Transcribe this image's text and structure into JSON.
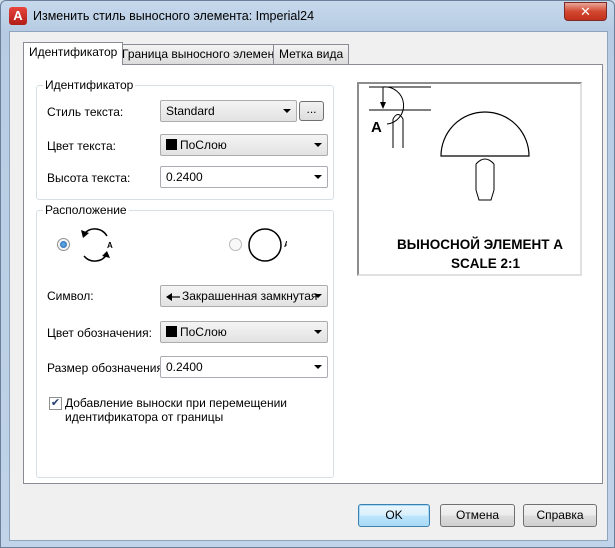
{
  "window": {
    "title": "Изменить стиль выносного элемента: Imperial24",
    "close_symbol": "✕"
  },
  "tabs": [
    {
      "label": "Идентификатор",
      "active": true
    },
    {
      "label": "Граница выносного элемента",
      "active": false
    },
    {
      "label": "Метка вида",
      "active": false
    }
  ],
  "identifier_group": {
    "title": "Идентификатор",
    "text_style_label": "Стиль текста:",
    "text_style_value": "Standard",
    "browse_label": "...",
    "text_color_label": "Цвет текста:",
    "text_color_value": "ПоСлою",
    "text_height_label": "Высота текста:",
    "text_height_value": "0.2400"
  },
  "layout_group": {
    "title": "Расположение",
    "option1_letter": "A",
    "option2_letter": "A",
    "option1_selected": true,
    "symbol_label": "Символ:",
    "symbol_value": "Закрашенная замкнутая",
    "marker_color_label": "Цвет обозначения:",
    "marker_color_value": "ПоСлою",
    "marker_size_label": "Размер обозначения:",
    "marker_size_value": "0.2400",
    "checkbox_checked": true,
    "checkbox_label_line1": "Добавление выноски при перемещении",
    "checkbox_label_line2": "идентификатора от границы"
  },
  "preview": {
    "marker_letter": "A",
    "caption_line1": "ВЫНОСНОЙ ЭЛЕМЕНТ А",
    "caption_line2": "SCALE 2:1"
  },
  "buttons": {
    "ok": "OK",
    "cancel": "Отмена",
    "help": "Справка"
  },
  "colors": {
    "accent_close": "#c2301c",
    "swatch": "#000000"
  }
}
